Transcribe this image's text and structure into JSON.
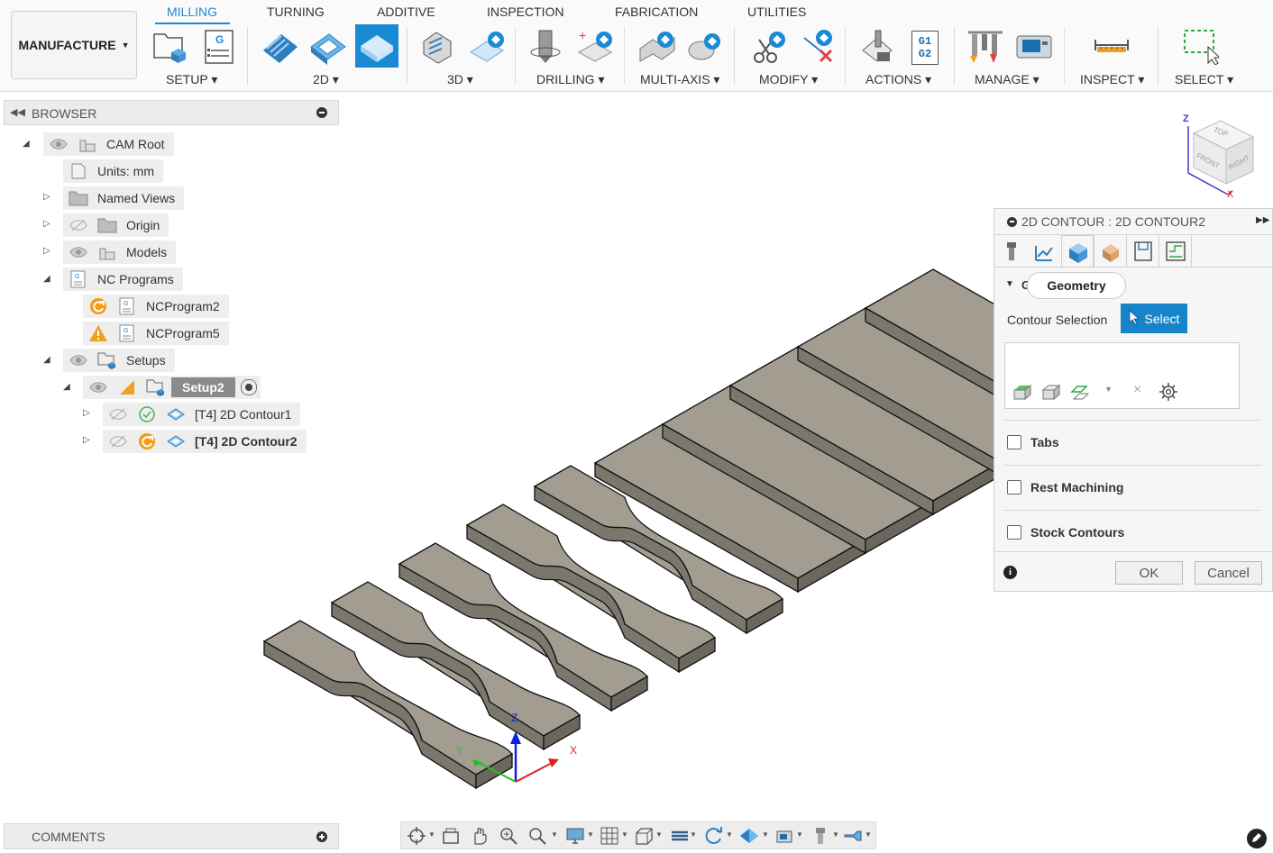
{
  "workspace": {
    "label": "MANUFACTURE"
  },
  "tabs": [
    "MILLING",
    "TURNING",
    "ADDITIVE",
    "INSPECTION",
    "FABRICATION",
    "UTILITIES"
  ],
  "groups": {
    "setup": "SETUP",
    "two_d": "2D",
    "three_d": "3D",
    "drilling": "DRILLING",
    "multi_axis": "MULTI-AXIS",
    "modify": "MODIFY",
    "actions": "ACTIONS",
    "manage": "MANAGE",
    "inspect": "INSPECT",
    "select": "SELECT"
  },
  "actions_icon_text": {
    "line1": "G1",
    "line2": "G2"
  },
  "browser": {
    "title": "BROWSER",
    "items": {
      "cam_root": "CAM Root",
      "units": "Units: mm",
      "named_views": "Named Views",
      "origin": "Origin",
      "models": "Models",
      "nc_programs": "NC Programs",
      "ncprogram2": "NCProgram2",
      "ncprogram5": "NCProgram5",
      "setups": "Setups",
      "setup2": "Setup2",
      "contour1": "[T4] 2D Contour1",
      "contour2": "[T4] 2D Contour2"
    }
  },
  "comments": {
    "title": "COMMENTS"
  },
  "viewcube": {
    "top": "TOP",
    "front": "FRONT",
    "right": "RIGHT",
    "z": "Z",
    "x": "X"
  },
  "triad": {
    "z": "Z",
    "x": "X",
    "y": "Y"
  },
  "dialog": {
    "title": "2D CONTOUR : 2D CONTOUR2",
    "section": "Geometry",
    "section_letter": "G",
    "contour_selection": "Contour Selection",
    "select_btn": "Select",
    "tabs_label": "Tabs",
    "rest_label": "Rest Machining",
    "stock_label": "Stock Contours",
    "ok": "OK",
    "cancel": "Cancel"
  },
  "colors": {
    "accent": "#1a8ad4",
    "select_btn": "#1784c9",
    "part_top": "#a29c91",
    "part_side": "#7c776d",
    "warning": "#f0a020",
    "regen": "#f39c12",
    "ok_green": "#4caf50"
  }
}
